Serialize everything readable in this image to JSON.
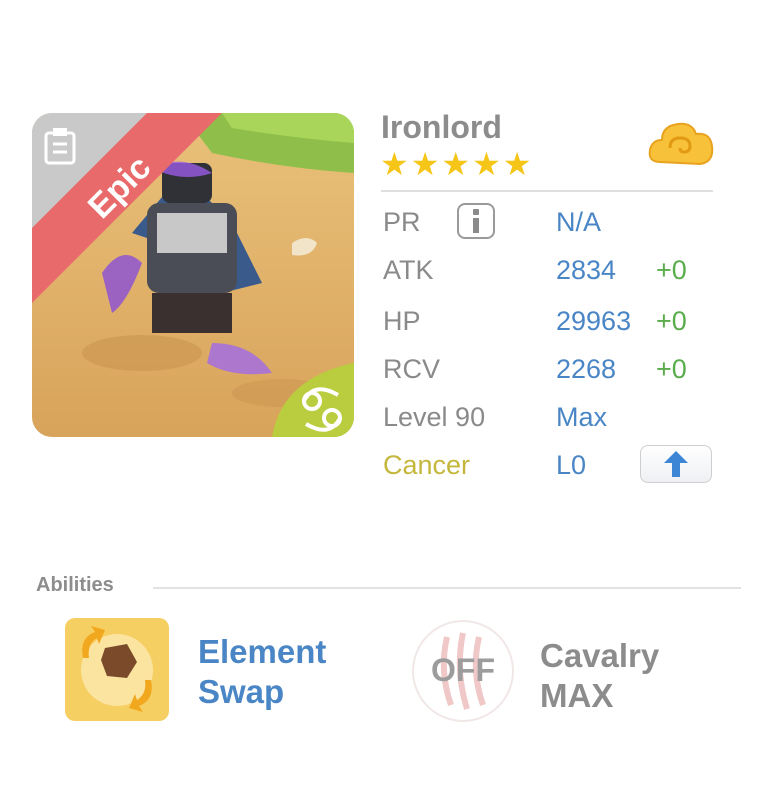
{
  "hero": {
    "name": "Ironlord",
    "rarity": "Epic",
    "star_count": 5,
    "star_glyph": "★",
    "portrait_icon": "knight-portrait",
    "sign_icon": "cancer-zodiac-icon"
  },
  "stats": {
    "pr_label": "PR",
    "pr_value": "N/A",
    "info_icon": "info-icon",
    "rows": [
      {
        "label": "ATK",
        "value": "2834",
        "bonus": "+0"
      },
      {
        "label": "HP",
        "value": "29963",
        "bonus": "+0"
      },
      {
        "label": "RCV",
        "value": "2268",
        "bonus": "+0"
      }
    ],
    "level_label": "Level 90",
    "level_value": "Max",
    "sign_label": "Cancer",
    "sign_value": "L0",
    "upgrade_icon": "up-arrow-icon"
  },
  "abilities": {
    "heading": "Abilities",
    "items": [
      {
        "name_line1": "Element",
        "name_line2": "Swap",
        "icon": "element-swap-icon"
      },
      {
        "name_line1": "Cavalry",
        "name_line2": "MAX",
        "icon": "claw-marks-icon",
        "state": "OFF"
      }
    ]
  },
  "colors": {
    "accent_blue": "#4a86c5",
    "bonus_green": "#5aad4b",
    "star_gold": "#f5c518",
    "epic_red": "#e86a6a",
    "sign_yellow": "#c4b73c"
  }
}
